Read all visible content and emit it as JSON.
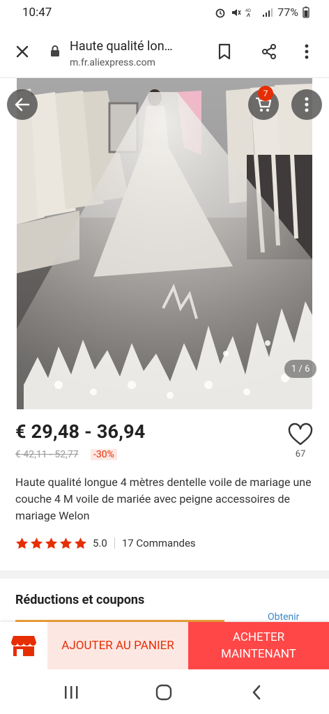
{
  "status": {
    "time": "10:47",
    "battery": "77%"
  },
  "browser": {
    "title": "Haute qualité lon…",
    "url": "m.fr.aliexpress.com"
  },
  "gallery": {
    "cart_count": "7",
    "counter": "1 / 6"
  },
  "product": {
    "price": "€ 29,48 - 36,94",
    "old_price": "€ 42,11 - 52,77",
    "discount": "-30%",
    "wish_count": "67",
    "title": "Haute qualité longue 4 mètres dentelle voile de mariage une couche 4 M voile de mariée avec peigne accessoires de mariage Welon",
    "rating": "5.0",
    "orders": "17 Commandes"
  },
  "coupons": {
    "title": "Réductions et coupons",
    "obtain": "Obtenir"
  },
  "actions": {
    "add_to_cart": "AJOUTER AU PANIER",
    "buy_now": "ACHETER MAINTENANT"
  },
  "colors": {
    "accent": "#ff4747",
    "accent_dark": "#e62e04",
    "add_cart_bg": "#fde7e3"
  },
  "icons": [
    "close-icon",
    "lock-icon",
    "bookmark-icon",
    "share-icon",
    "more-icon",
    "back-icon",
    "cart-icon",
    "heart-icon",
    "star-icon",
    "store-icon"
  ]
}
